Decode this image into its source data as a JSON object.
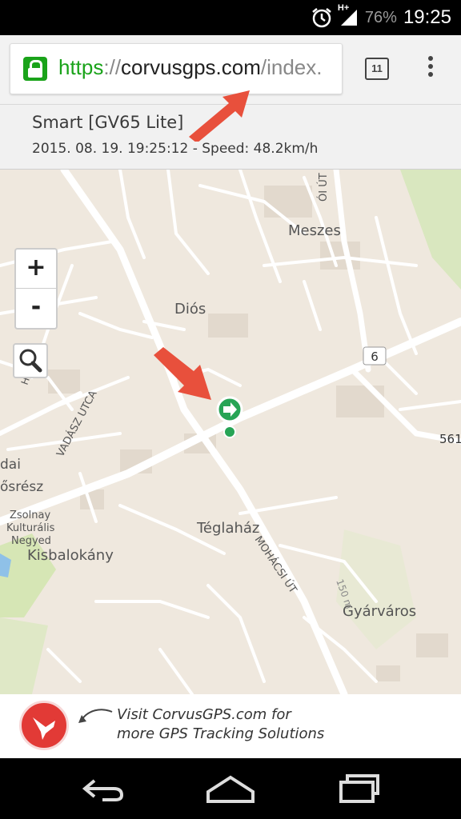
{
  "status_bar": {
    "network": "H+",
    "battery": "76%",
    "time": "19:25",
    "icons": [
      "alarm-icon",
      "signal-icon",
      "battery-icon"
    ]
  },
  "browser": {
    "url_scheme": "https",
    "url_separator": "://",
    "url_domain": "corvusgps.com",
    "url_path": "/index.",
    "tab_count": "11",
    "icons": [
      "lock-icon",
      "tabs-icon",
      "overflow-menu-icon"
    ]
  },
  "tracker": {
    "device_name": "Smart [GV65 Lite]",
    "status_line": "2015. 08. 19. 19:25:12 - Speed: 48.2km/h"
  },
  "map": {
    "zoom_in_label": "+",
    "zoom_out_label": "-",
    "road_number_6": "6",
    "road_number_561": "561",
    "scale_label": "150 m",
    "places": {
      "meszes": "Meszes",
      "dios": "Diós",
      "teglahaz": "Téglaház",
      "kisbalokany": "Kisbalokány",
      "gyarvaros": "Gyárváros",
      "zsolnay_1": "Zsolnay",
      "zsolnay_2": "Kulturális",
      "zsolnay_3": "Negyed",
      "edge_dai": "dai",
      "edge_resz": "ősrész",
      "ut_top": "ÓI ÚT",
      "vadasz_utca": "VADÁSZ UTCA",
      "mohacsi_ut": "MOHÁCSI ÚT",
      "left_ut": "H ÚT"
    },
    "colors": {
      "background": "#efe8de",
      "road": "#ffffff",
      "park": "#d6e6b5",
      "marker": "#27a455",
      "annotation_arrow": "#e8503c"
    }
  },
  "ad": {
    "line1": "Visit CorvusGPS.com for",
    "line2": "more GPS Tracking Solutions"
  },
  "nav_bar": {
    "icons": [
      "back-icon",
      "home-icon",
      "recents-icon"
    ]
  }
}
